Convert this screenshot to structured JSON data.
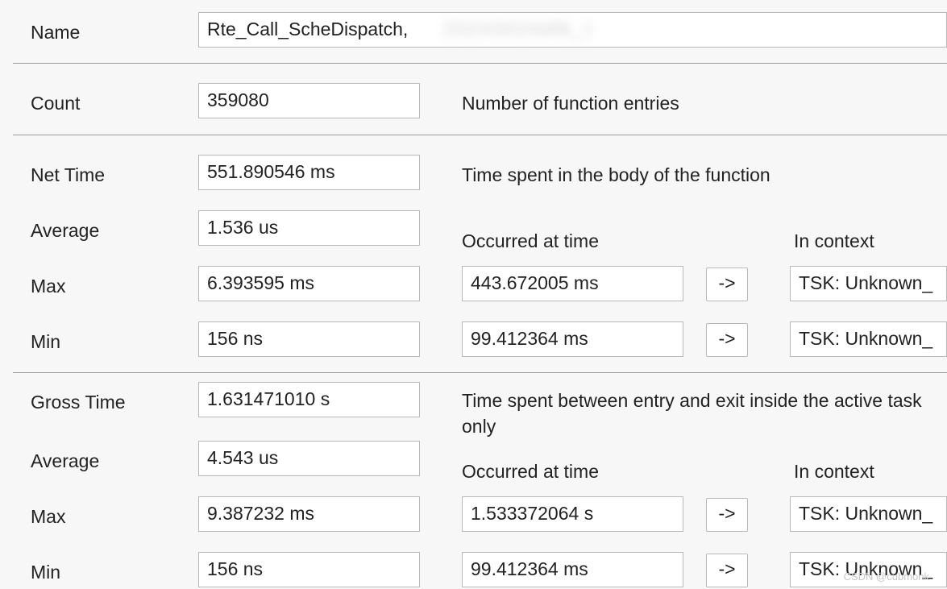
{
  "labels": {
    "name": "Name",
    "count": "Count",
    "netTime": "Net Time",
    "average": "Average",
    "max": "Max",
    "min": "Min",
    "grossTime": "Gross Time",
    "occurredAt": "Occurred at time",
    "inContext": "In context"
  },
  "descriptions": {
    "count": "Number of function entries",
    "netTime": "Time spent in the body of the function",
    "grossTime": "Time spent between entry and exit inside the active task only"
  },
  "name": {
    "value": "Rte_Call_ScheDispatch,",
    "obscured": "20243024dfk_t"
  },
  "count": {
    "value": "359080"
  },
  "netTime": {
    "total": "551.890546 ms",
    "average": "1.536 us",
    "max": {
      "value": "6.393595 ms",
      "at": "443.672005 ms",
      "context": "TSK: Unknown_"
    },
    "min": {
      "value": "156 ns",
      "at": "99.412364 ms",
      "context": "TSK: Unknown_"
    }
  },
  "grossTime": {
    "total": "1.631471010 s",
    "average": "4.543 us",
    "max": {
      "value": "9.387232 ms",
      "at": "1.533372064 s",
      "context": "TSK: Unknown_"
    },
    "min": {
      "value": "156 ns",
      "at": "99.412364 ms",
      "context": "TSK: Unknown_"
    }
  },
  "goto": "->",
  "watermark": "CSDN @cubmonk"
}
